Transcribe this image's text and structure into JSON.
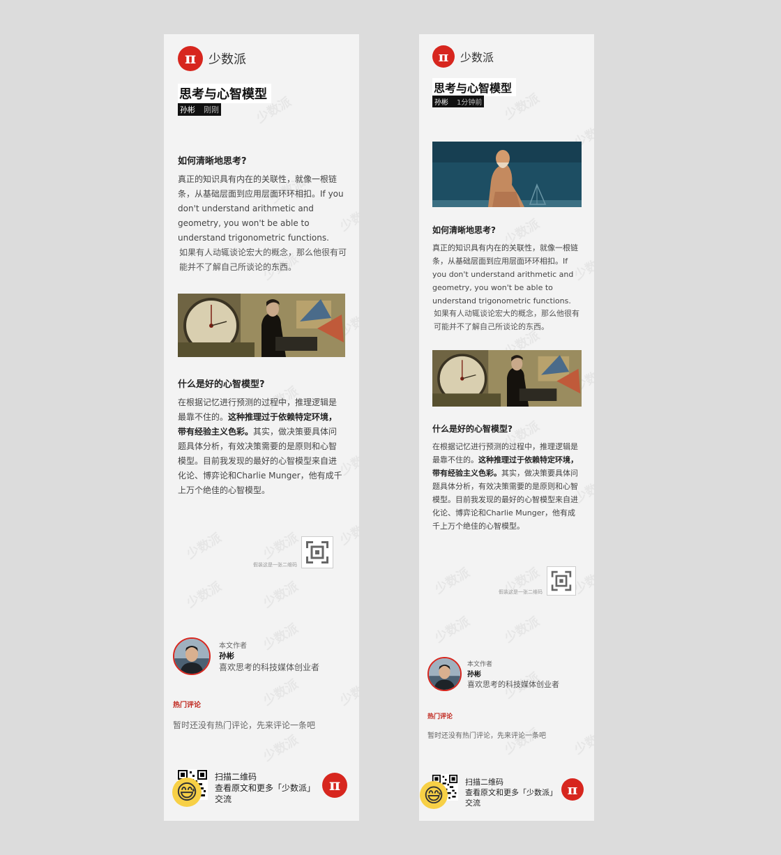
{
  "brand": {
    "name": "少数派",
    "logo_glyph": "π",
    "accent": "#d7261e"
  },
  "article": {
    "title": "思考与心智模型",
    "section1_heading": "如何清晰地思考?",
    "section1_text": "真正的知识具有内在的关联性，就像一根链条，从基础层面到应用层面环环相扣。If you don't understand arithmetic and geometry, you won't be able to understand trigonometric functions.",
    "section1_quote": "如果有人动辄谈论宏大的概念，那么他很有可能并不了解自己所谈论的东西。",
    "section2_heading": "什么是好的心智模型?",
    "section2_pre": "在根据记忆进行预测的过程中，推理逻辑是最靠不住的。",
    "section2_bold": "这种推理过于依赖特定环境，带有经验主义色彩。",
    "section2_post": "其实，做决策要具体问题具体分析，有效决策需要的是原则和心智模型。目前我发现的最好的心智模型来自进化论、博弈论和Charlie Munger，他有成千上万个绝佳的心智模型。"
  },
  "cards": [
    {
      "author_line": "孙彬",
      "time": "刚刚"
    },
    {
      "author_line": "孙彬",
      "time": "1分钟前"
    }
  ],
  "qr_caption": "假装这是一张二维码",
  "author": {
    "label": "本文作者",
    "name": "孙彬",
    "bio": "喜欢思考的科技媒体创业者"
  },
  "comments": {
    "heading": "热门评论",
    "empty": "暂时还没有热门评论，先来评论一条吧"
  },
  "footer": {
    "line1": "扫描二维码",
    "line2": "查看原文和更多「少数派」",
    "line3": "交流",
    "emoji": "😅"
  },
  "icons": {
    "qr": "qr-code-icon",
    "logo": "pi-logo-icon",
    "emoji": "sweat-smile-emoji-icon"
  }
}
